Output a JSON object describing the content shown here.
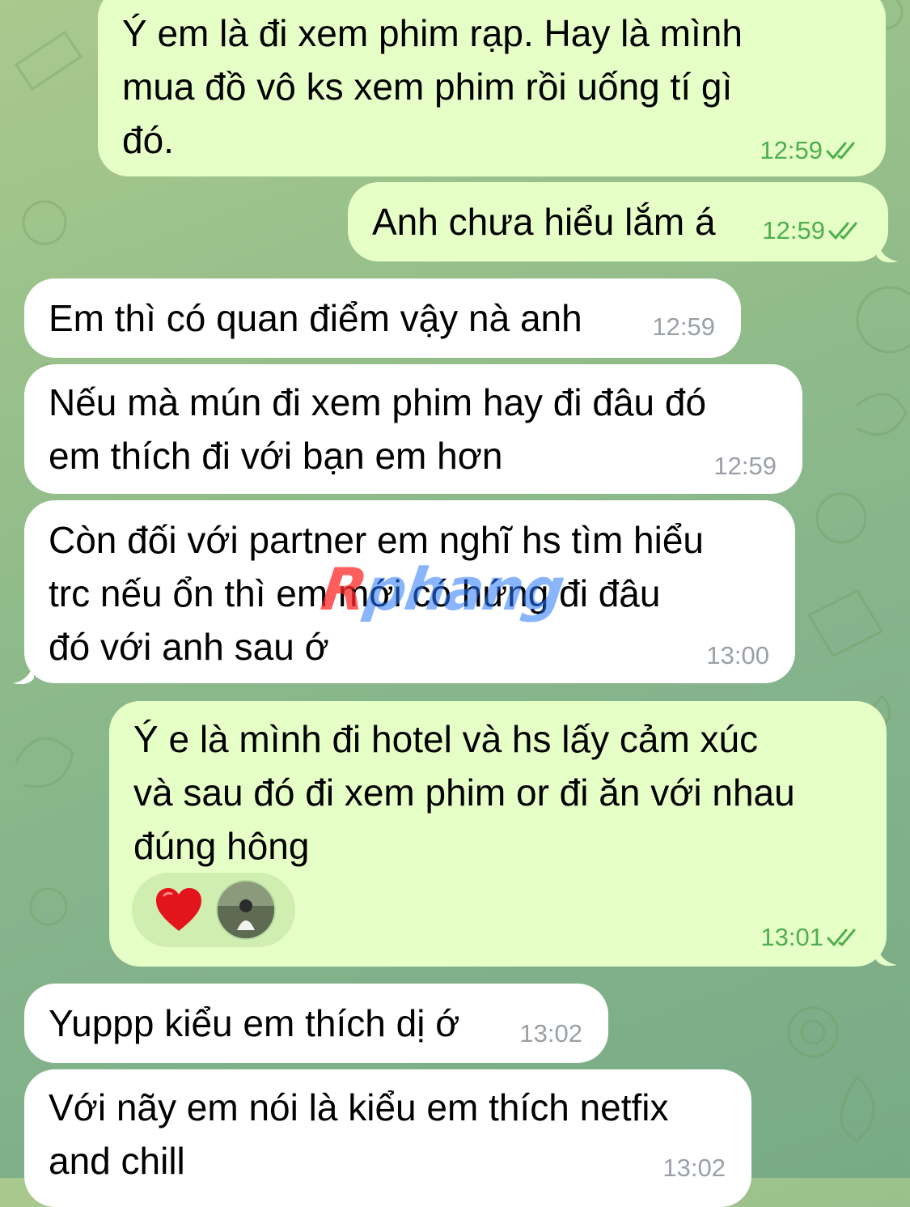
{
  "chat": {
    "messages": [
      {
        "direction": "outgoing",
        "text": "Ý em là đi xem phim rạp. Hay là mình\nmua đồ vô ks xem phim rồi uống tí gì\nđó.",
        "time": "12:59",
        "read": true
      },
      {
        "direction": "outgoing",
        "text": "Anh chưa hiểu lắm á",
        "time": "12:59",
        "read": true
      },
      {
        "direction": "incoming",
        "text": "Em thì có quan điểm vậy nà anh",
        "time": "12:59"
      },
      {
        "direction": "incoming",
        "text": "Nếu mà mún đi xem phim hay đi đâu đó\nem thích đi với bạn em hơn",
        "time": "12:59"
      },
      {
        "direction": "incoming",
        "text": "Còn đối với partner em nghĩ hs tìm hiểu\ntrc nếu ổn thì em mới có hứng đi đâu\nđó với anh sau ớ",
        "time": "13:00"
      },
      {
        "direction": "outgoing",
        "text": "Ý e là mình đi hotel và hs lấy cảm xúc\nvà sau đó đi xem phim or đi ăn với nhau\nđúng hông",
        "time": "13:01",
        "read": true,
        "reactions": [
          "heart-icon",
          "reactor-avatar"
        ]
      },
      {
        "direction": "incoming",
        "text": "Yuppp kiểu em thích dị ớ",
        "time": "13:02"
      },
      {
        "direction": "incoming",
        "text": "Với nãy em nói là kiểu em thích netfix\nand chill",
        "time": "13:02"
      }
    ]
  },
  "watermark": {
    "prefix": "R",
    "rest": "phang"
  },
  "colors": {
    "incoming_bubble": "#ffffff",
    "outgoing_bubble": "#e6ffc6",
    "outgoing_meta": "#4fae4e",
    "incoming_meta": "#9aa0a6"
  }
}
